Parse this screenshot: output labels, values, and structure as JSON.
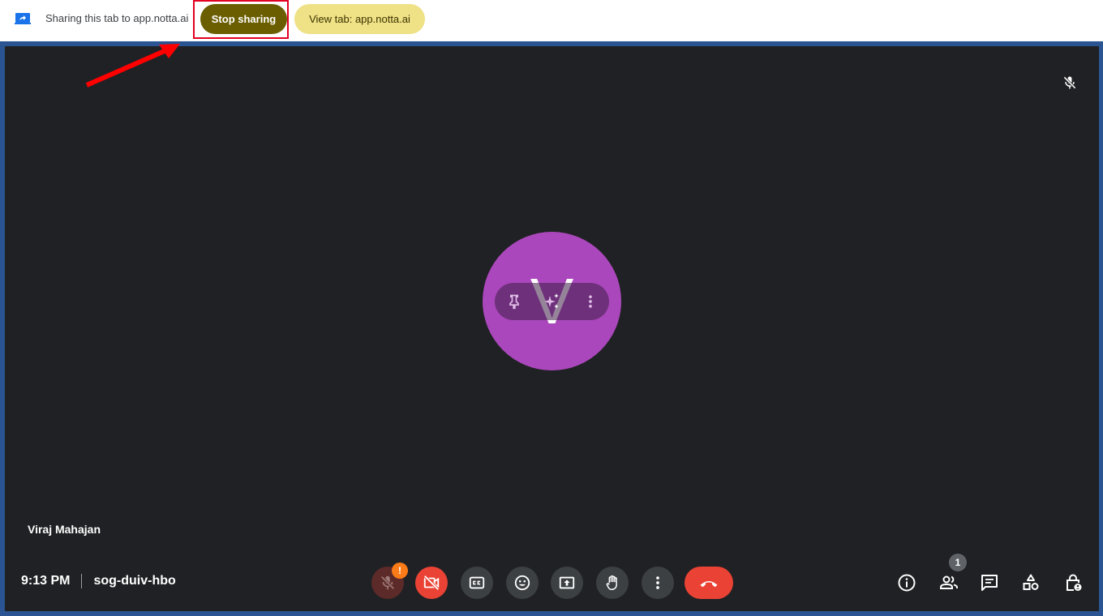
{
  "share_bar": {
    "icon": "tab-share-icon",
    "message": "Sharing this tab to app.notta.ai",
    "stop_label": "Stop sharing",
    "view_label": "View tab: app.notta.ai",
    "stop_color": "#6b5e00",
    "view_color": "#efe186"
  },
  "annotation": {
    "arrow_color": "#ff0000",
    "highlight_color": "#e30022"
  },
  "participant": {
    "name": "Viraj Mahajan",
    "initial": "V",
    "avatar_color": "#ab47bc",
    "muted": true
  },
  "tile_actions": {
    "pin_icon": "pin-icon",
    "effects_icon": "sparkle-icon",
    "more_icon": "more-vert-icon"
  },
  "meeting": {
    "time": "9:13 PM",
    "code": "sog-duiv-hbo"
  },
  "controls": {
    "mic": {
      "icon": "mic-off-icon",
      "state": "off",
      "warning": "!"
    },
    "camera": {
      "icon": "videocam-off-icon",
      "state": "off"
    },
    "captions": {
      "icon": "closed-caption-icon"
    },
    "reactions": {
      "icon": "emoji-icon"
    },
    "present": {
      "icon": "present-screen-icon"
    },
    "raise_hand": {
      "icon": "hand-icon"
    },
    "more": {
      "icon": "more-vert-icon"
    },
    "leave": {
      "icon": "call-end-icon"
    }
  },
  "side_controls": {
    "info": {
      "icon": "info-icon"
    },
    "people": {
      "icon": "people-icon",
      "count": "1"
    },
    "chat": {
      "icon": "chat-icon"
    },
    "activities": {
      "icon": "activities-icon"
    },
    "host_controls": {
      "icon": "lock-person-icon"
    }
  }
}
